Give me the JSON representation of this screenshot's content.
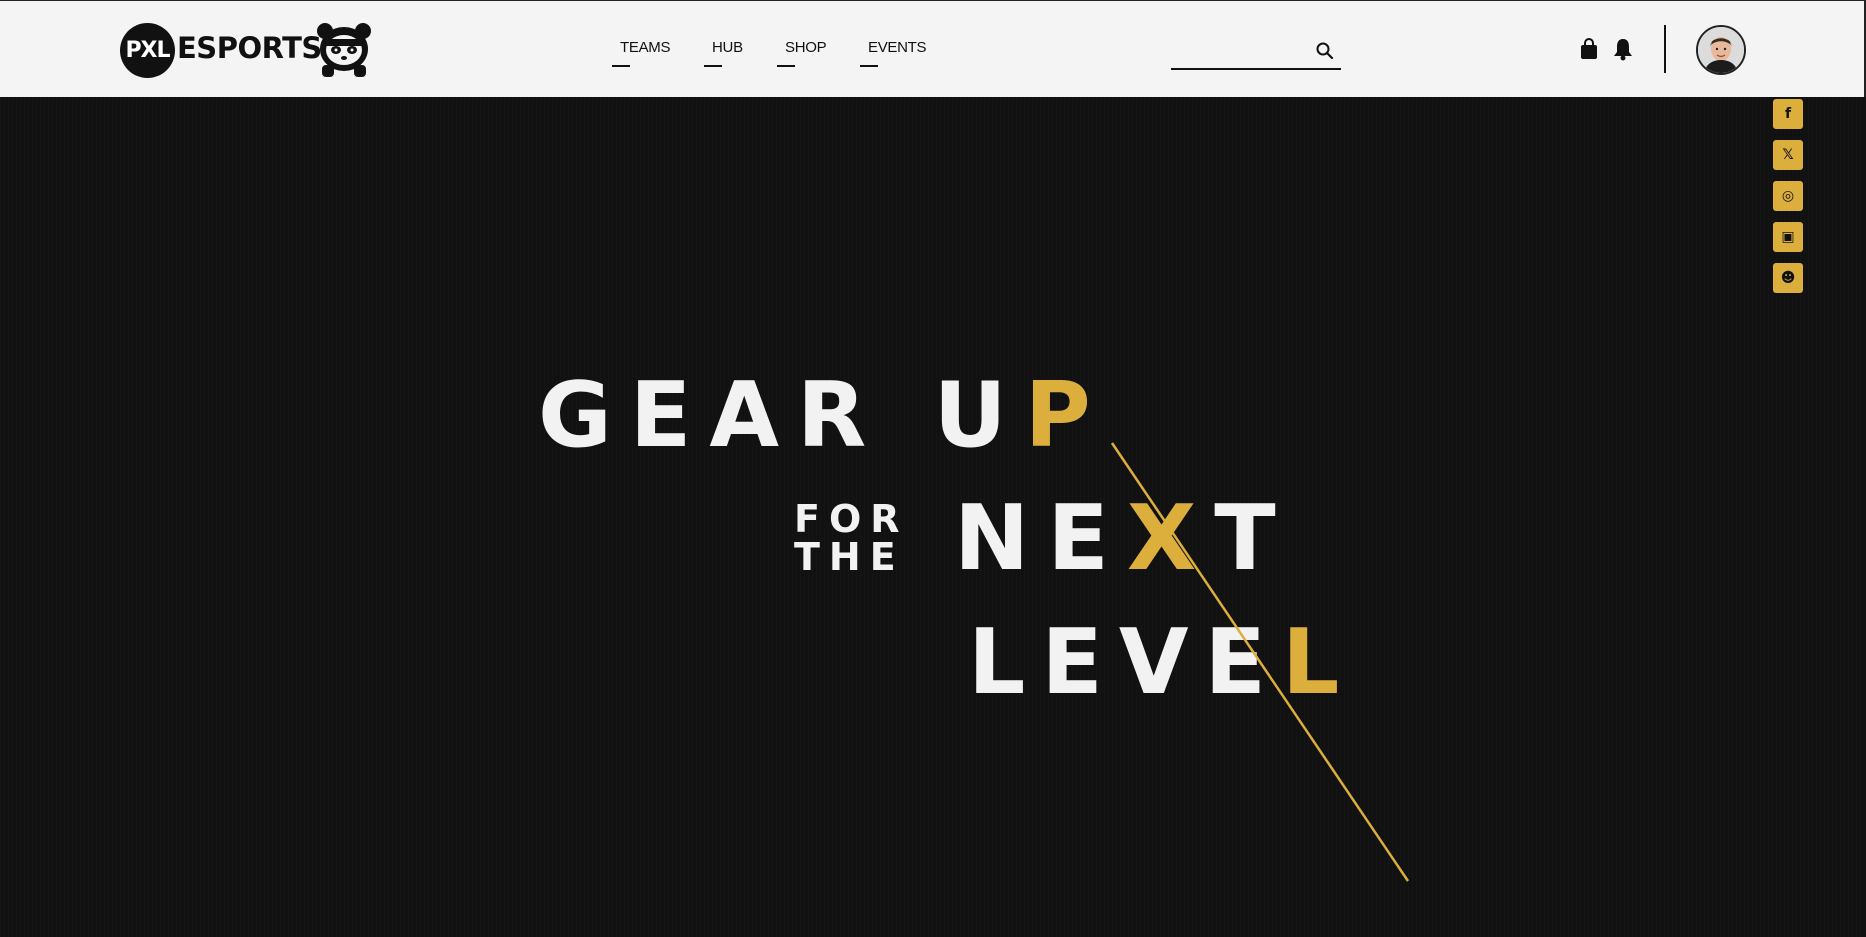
{
  "header": {
    "logo_mark": "PXL",
    "logo_text": "ESPORTS",
    "nav": [
      {
        "label": "TEAMS"
      },
      {
        "label": "HUB"
      },
      {
        "label": "SHOP"
      },
      {
        "label": "EVENTS"
      }
    ],
    "search": {
      "value": "",
      "placeholder": ""
    },
    "icons": {
      "search": "search-icon",
      "bag": "shopping-bag-icon",
      "bell": "notification-bell-icon",
      "avatar": "user-avatar"
    }
  },
  "social": [
    {
      "name": "facebook",
      "glyph": "f"
    },
    {
      "name": "x",
      "glyph": "𝕏"
    },
    {
      "name": "instagram",
      "glyph": "◎"
    },
    {
      "name": "twitch",
      "glyph": "▣"
    },
    {
      "name": "discord",
      "glyph": "☻"
    }
  ],
  "hero": {
    "line1_white": "GEAR U",
    "line1_gold": "P",
    "line2_small_top": "FOR",
    "line2_small_bottom": "THE",
    "line2_white": "NE",
    "line2_gold": "X",
    "line2_end": "T",
    "line3_white": "LEVE",
    "line3_gold": "L"
  },
  "colors": {
    "accent": "#dcae3c",
    "background": "#111111",
    "header": "#f4f4f4",
    "text_light": "#f2f2f2"
  }
}
